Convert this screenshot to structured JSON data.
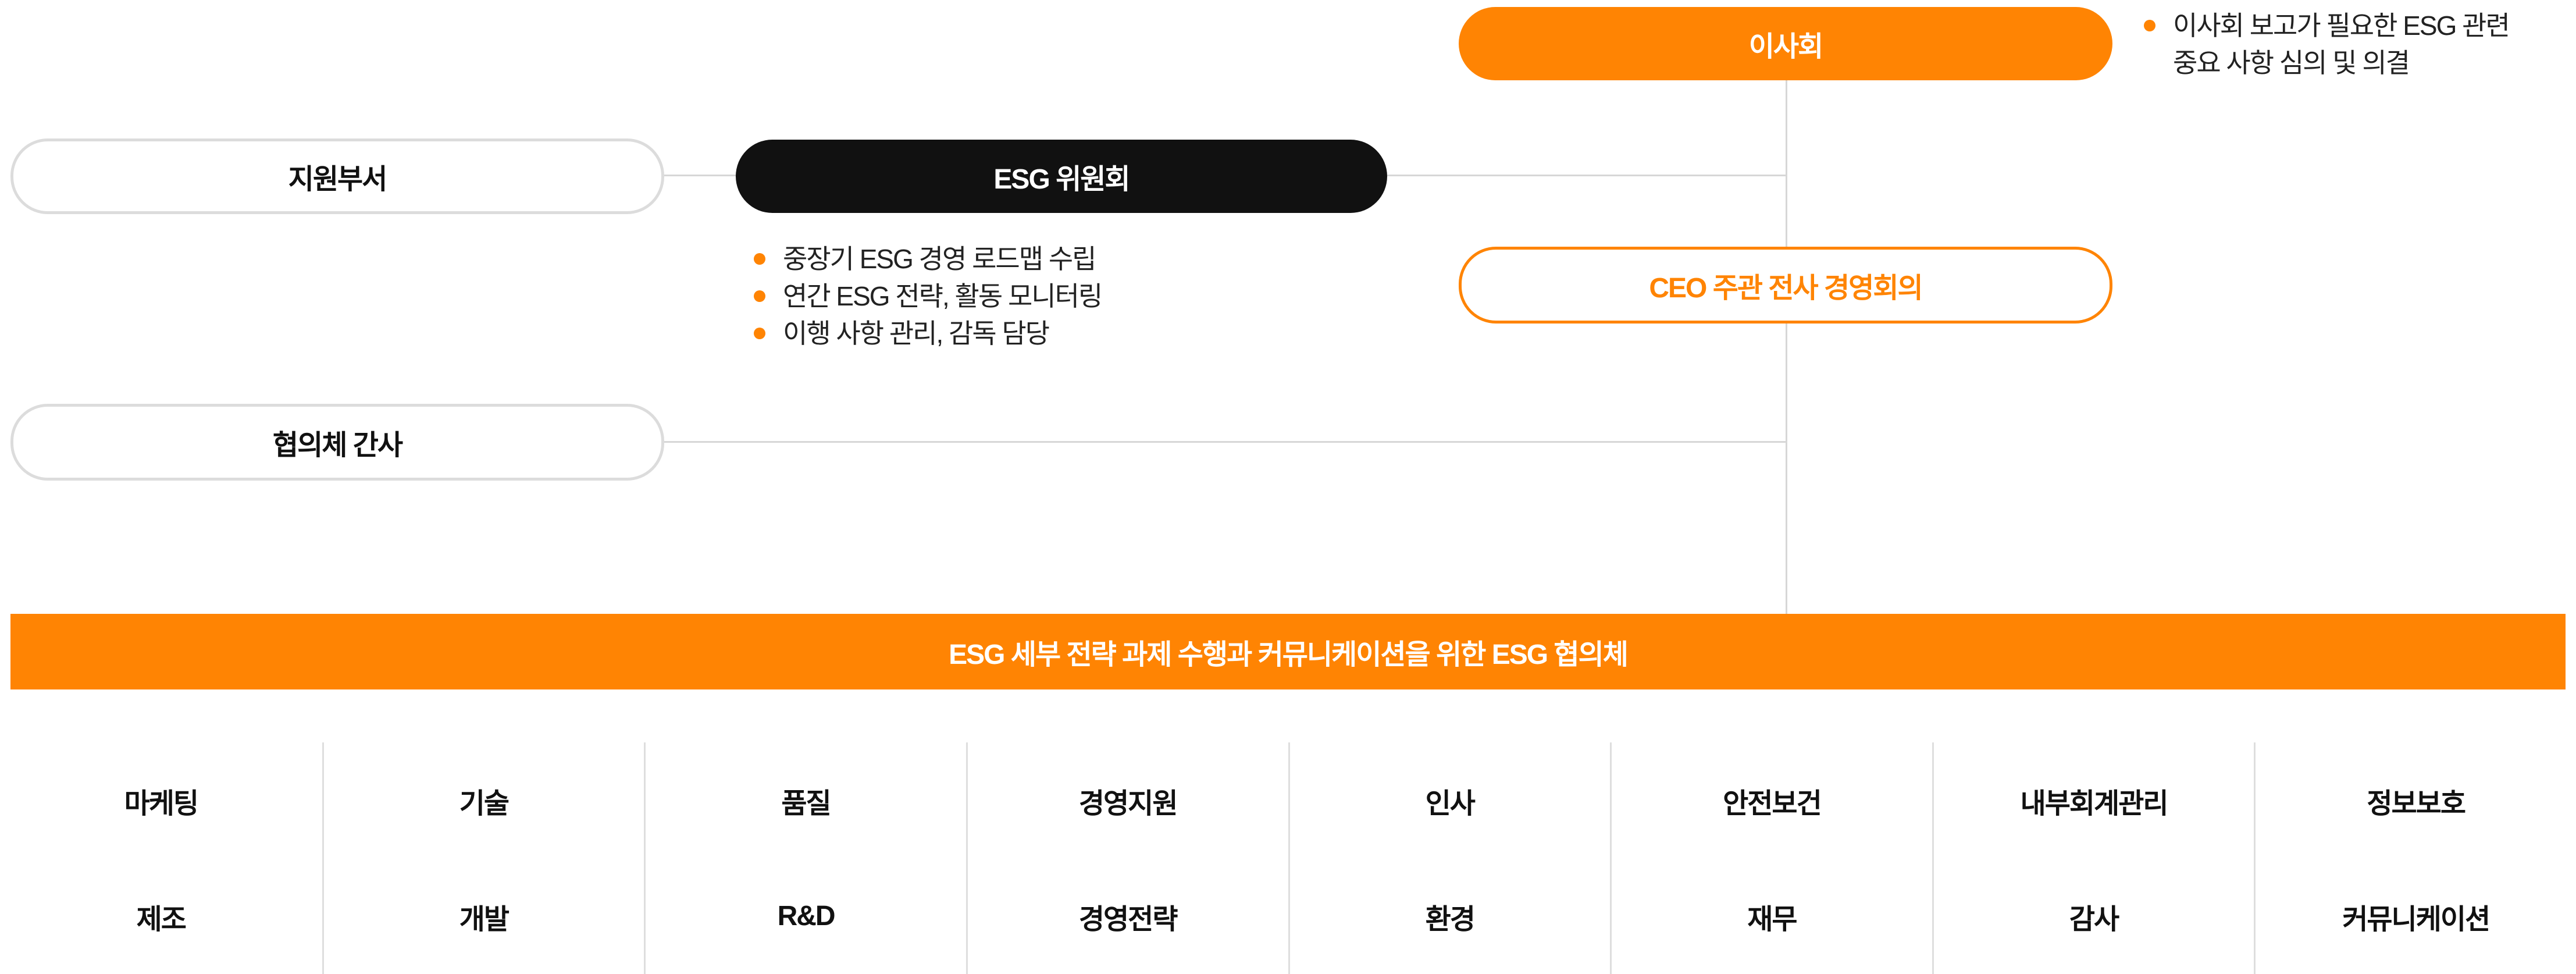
{
  "top": {
    "board": "이사회",
    "board_notes": [
      "이사회 보고가 필요한 ESG 관련",
      "중요 사항 심의 및 의결"
    ],
    "ceo_meeting": "CEO 주관 전사 경영회의"
  },
  "committee": {
    "title": "ESG 위원회",
    "duties": [
      "중장기 ESG 경영 로드맵 수립",
      "연간 ESG 전략, 활동 모니터링",
      "이행 사항 관리, 감독 담당"
    ]
  },
  "support": {
    "dept": "지원부서",
    "council_secretary": "협의체 간사"
  },
  "banner": "ESG 세부 전략 과제 수행과 커뮤니케이션을 위한 ESG 협의체",
  "council_members": {
    "row1": [
      "마케팅",
      "기술",
      "품질",
      "경영지원",
      "인사",
      "안전보건",
      "내부회계관리",
      "정보보호"
    ],
    "row2": [
      "제조",
      "개발",
      "R&D",
      "경영전략",
      "환경",
      "재무",
      "감사",
      "커뮤니케이션"
    ]
  },
  "colors": {
    "accent": "#ff8403",
    "dark": "#111111",
    "line": "#d7d7d7"
  }
}
